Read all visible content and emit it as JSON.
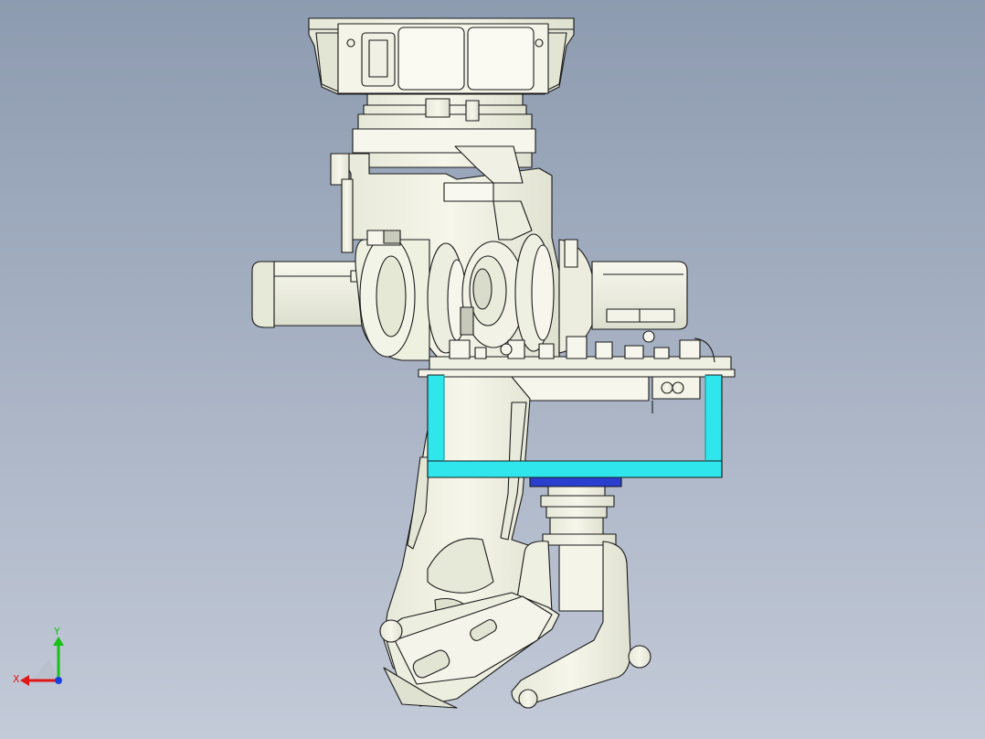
{
  "viewport": {
    "background_top": "#8d9bb0",
    "background_bottom": "#c3cad8"
  },
  "model": {
    "part_fill": "#f3f3e6",
    "part_shadow": "#d9dccb",
    "edge_color": "#1a1a1a",
    "frame_color": "#2fe6ec",
    "flange_color": "#2a3fd0"
  },
  "triad": {
    "x_label": "X",
    "y_label": "Y",
    "x_color": "#e01818",
    "y_color": "#18c018",
    "z_color": "#1840e0"
  }
}
